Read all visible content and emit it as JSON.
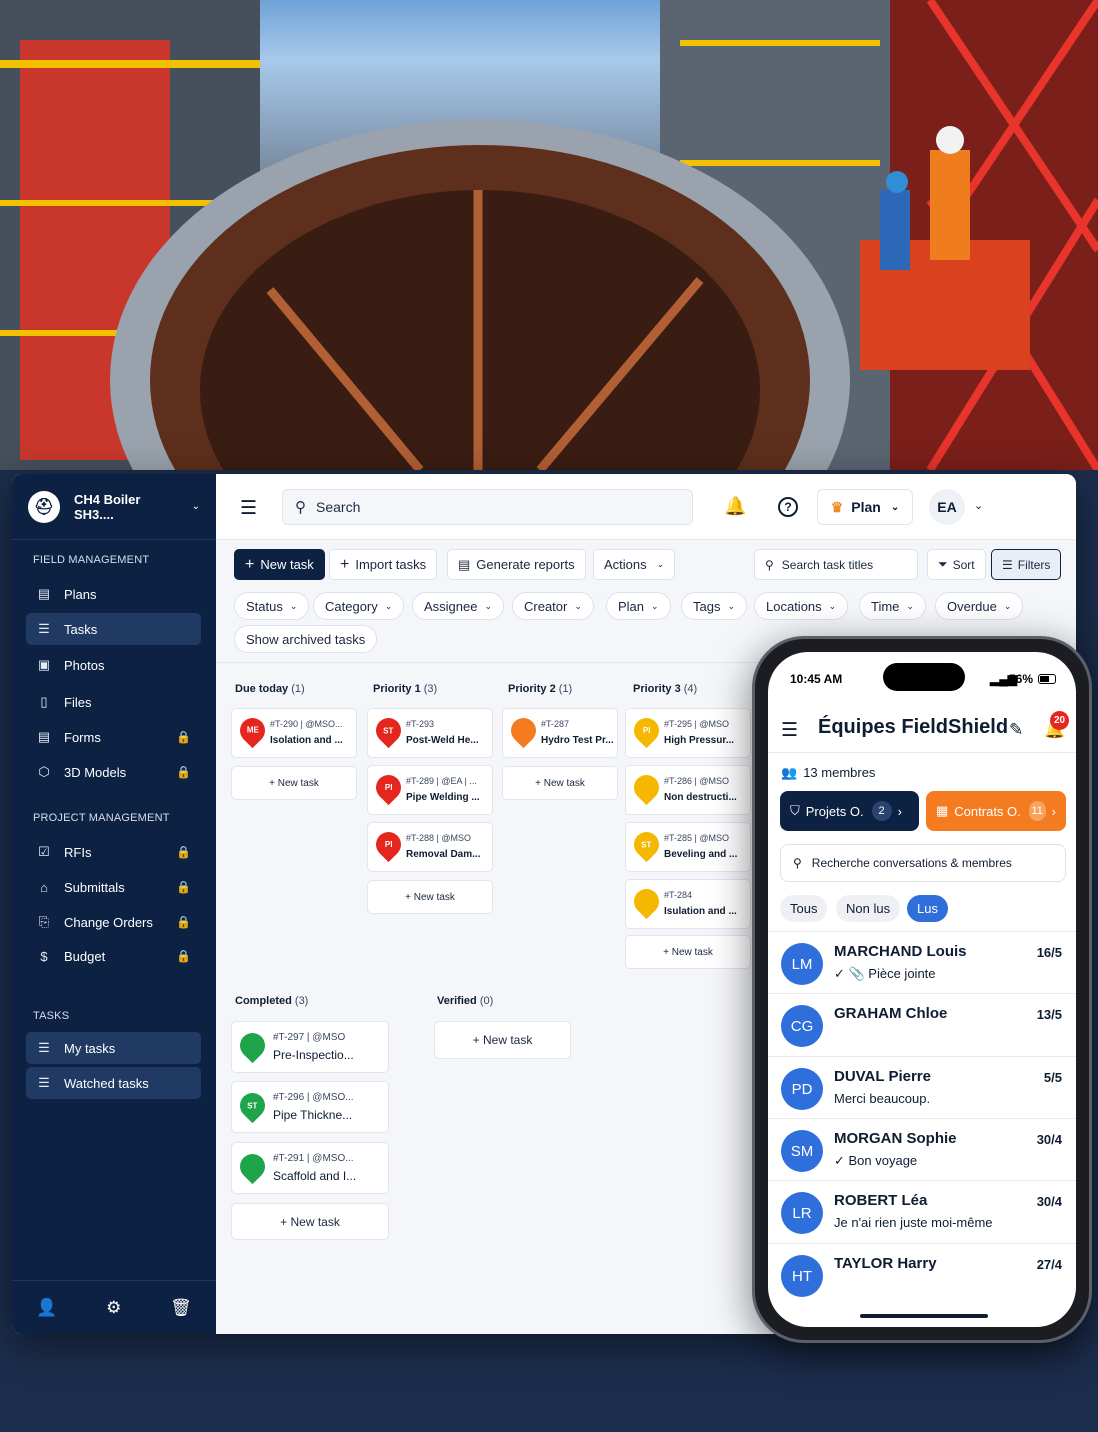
{
  "sidebar": {
    "project_name": "CH4 Boiler SH3....",
    "section_field": "FIELD MANAGEMENT",
    "field_items": [
      {
        "label": "Plans"
      },
      {
        "label": "Tasks"
      },
      {
        "label": "Photos"
      },
      {
        "label": "Files"
      },
      {
        "label": "Forms"
      },
      {
        "label": "3D Models"
      }
    ],
    "section_project": "PROJECT MANAGEMENT",
    "project_items": [
      {
        "label": "RFIs"
      },
      {
        "label": "Submittals"
      },
      {
        "label": "Change Orders"
      },
      {
        "label": "Budget"
      }
    ],
    "section_tasks": "TASKS",
    "task_items": [
      {
        "label": "My tasks"
      },
      {
        "label": "Watched tasks"
      }
    ]
  },
  "topbar": {
    "search_placeholder": "Search",
    "plan_label": "Plan",
    "user_initials": "EA"
  },
  "toolbar": {
    "new_task": "New task",
    "import_tasks": "Import tasks",
    "generate_reports": "Generate reports",
    "actions": "Actions",
    "search_titles": "Search task titles",
    "sort": "Sort",
    "filters": "Filters"
  },
  "filters": [
    "Status",
    "Category",
    "Assignee",
    "Creator",
    "Plan",
    "Tags",
    "Locations",
    "Time",
    "Overdue"
  ],
  "show_archived": "Show archived tasks",
  "columns": [
    {
      "title": "Due today",
      "count": "(1)",
      "cards": [
        {
          "id": "#T-290 | @MSO...",
          "title": "Isolation and ...",
          "badge": "ME",
          "color": "#e5261e"
        }
      ]
    },
    {
      "title": "Priority 1",
      "count": "(3)",
      "cards": [
        {
          "id": "#T-293",
          "title": "Post-Weld He...",
          "badge": "ST",
          "color": "#e5261e"
        },
        {
          "id": "#T-289 | @EA | ...",
          "title": "Pipe Welding ...",
          "badge": "PI",
          "color": "#e5261e"
        },
        {
          "id": "#T-288 | @MSO",
          "title": "Removal Dam...",
          "badge": "PI",
          "color": "#e5261e"
        }
      ]
    },
    {
      "title": "Priority 2",
      "count": "(1)",
      "cards": [
        {
          "id": "#T-287",
          "title": "Hydro Test Pr...",
          "badge": "",
          "color": "#f47b20"
        }
      ]
    },
    {
      "title": "Priority 3",
      "count": "(4)",
      "cards": [
        {
          "id": "#T-295 | @MSO",
          "title": "High Pressur...",
          "badge": "PI",
          "color": "#f5b700"
        },
        {
          "id": "#T-286 | @MSO",
          "title": "Non destructi...",
          "badge": "",
          "color": "#f5b700"
        },
        {
          "id": "#T-285 | @MSO",
          "title": "Beveling and ...",
          "badge": "ST",
          "color": "#f5b700"
        },
        {
          "id": "#T-284",
          "title": "Isulation and ...",
          "badge": "",
          "color": "#f5b700"
        }
      ]
    },
    {
      "title": "Completed",
      "count": "(3)",
      "cards": [
        {
          "id": "#T-297 | @MSO",
          "title": "Pre-Inspectio...",
          "badge": "",
          "color": "#1ea44b"
        },
        {
          "id": "#T-296 | @MSO...",
          "title": "Pipe Thickne...",
          "badge": "ST",
          "color": "#1ea44b"
        },
        {
          "id": "#T-291 | @MSO...",
          "title": "Scaffold and I...",
          "badge": "",
          "color": "#1ea44b"
        }
      ]
    },
    {
      "title": "Verified",
      "count": "(0)",
      "cards": []
    }
  ],
  "new_task_label": "+ New task",
  "phone": {
    "time": "10:45 AM",
    "battery": "56%",
    "title": "Équipes FieldShield",
    "notif_count": "20",
    "members": "13 membres",
    "projets_label": "Projets O.",
    "projets_count": "2",
    "contrats_label": "Contrats O.",
    "contrats_count": "11",
    "search_placeholder": "Recherche conversations & membres",
    "tabs": [
      "Tous",
      "Non lus",
      "Lus"
    ],
    "conversations": [
      {
        "initials": "LM",
        "name": "MARCHAND Louis",
        "date": "16/5",
        "preview": "✓ 📎 Pièce jointe"
      },
      {
        "initials": "CG",
        "name": "GRAHAM Chloe",
        "date": "13/5",
        "preview": ""
      },
      {
        "initials": "PD",
        "name": "DUVAL Pierre",
        "date": "5/5",
        "preview": "Merci beaucoup."
      },
      {
        "initials": "SM",
        "name": "MORGAN Sophie",
        "date": "30/4",
        "preview": "✓ Bon voyage"
      },
      {
        "initials": "LR",
        "name": "ROBERT Léa",
        "date": "30/4",
        "preview": "Je n'ai rien juste moi-même"
      },
      {
        "initials": "HT",
        "name": "TAYLOR Harry",
        "date": "27/4",
        "preview": ""
      }
    ]
  },
  "colors": {
    "navy": "#0d2143",
    "accent_blue": "#2f6fdb",
    "orange": "#f47b20",
    "red": "#e5261e",
    "yellow": "#f5b700",
    "green": "#1ea44b"
  }
}
